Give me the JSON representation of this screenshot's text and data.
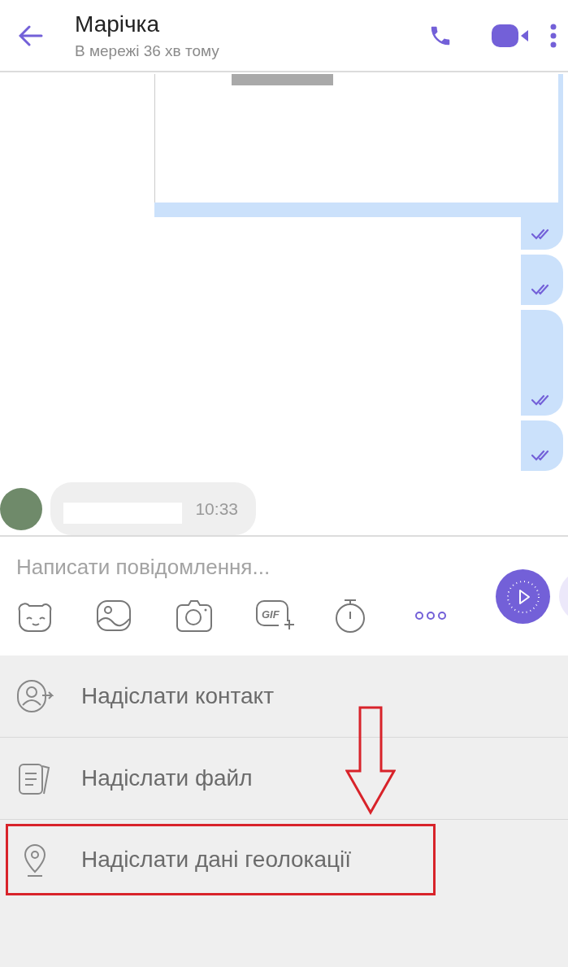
{
  "header": {
    "title": "Марічка",
    "status": "В мережі 36 хв тому"
  },
  "messages": [
    {
      "kind": "large"
    },
    {
      "kind": "small"
    },
    {
      "kind": "tall"
    },
    {
      "kind": "small"
    },
    {
      "kind": "incoming",
      "time": "10:33"
    }
  ],
  "composer": {
    "placeholder": "Написати повідомлення...",
    "tools": [
      {
        "kind": "sticker"
      },
      {
        "kind": "gallery"
      },
      {
        "kind": "camera"
      },
      {
        "kind": "gif",
        "label": "GIF"
      },
      {
        "kind": "timer"
      },
      {
        "kind": "more"
      }
    ]
  },
  "menu": [
    {
      "kind": "contact",
      "label": "Надіслати контакт",
      "highlighted": false
    },
    {
      "kind": "file",
      "label": "Надіслати файл",
      "highlighted": false
    },
    {
      "kind": "location",
      "label": "Надіслати дані геолокації",
      "highlighted": true
    }
  ]
}
